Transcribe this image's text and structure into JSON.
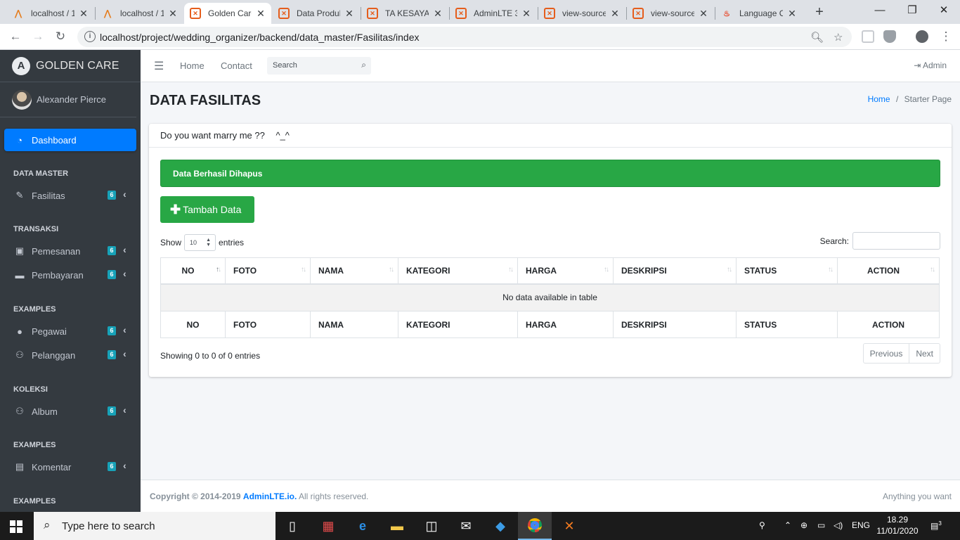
{
  "browser": {
    "tabs": [
      {
        "title": "localhost / 1",
        "icon": "phpmyadmin-icon"
      },
      {
        "title": "localhost / 1",
        "icon": "phpmyadmin-icon"
      },
      {
        "title": "Golden Care",
        "icon": "xampp-icon",
        "active": true
      },
      {
        "title": "Data Produk",
        "icon": "xampp-icon"
      },
      {
        "title": "TA KESAYAN",
        "icon": "xampp-icon"
      },
      {
        "title": "AdminLTE 3",
        "icon": "xampp-icon"
      },
      {
        "title": "view-source",
        "icon": "xampp-icon"
      },
      {
        "title": "view-source",
        "icon": "xampp-icon"
      },
      {
        "title": "Language C",
        "icon": "flame-icon"
      }
    ],
    "url": "localhost/project/wedding_organizer/backend/data_master/Fasilitas/index"
  },
  "sidebar": {
    "brand": "GOLDEN CARE",
    "user": "Alexander Pierce",
    "dashboard": "Dashboard",
    "sections": [
      {
        "header": "DATA MASTER",
        "items": [
          {
            "label": "Fasilitas",
            "badge": "6",
            "icon": "edit-icon"
          }
        ]
      },
      {
        "header": "TRANSAKSI",
        "items": [
          {
            "label": "Pemesanan",
            "badge": "6",
            "icon": "briefcase-icon"
          },
          {
            "label": "Pembayaran",
            "badge": "6",
            "icon": "wallet-icon"
          }
        ]
      },
      {
        "header": "EXAMPLES",
        "items": [
          {
            "label": "Pegawai",
            "badge": "6",
            "icon": "user-icon"
          },
          {
            "label": "Pelanggan",
            "badge": "6",
            "icon": "users-icon"
          }
        ]
      },
      {
        "header": "KOLEKSI",
        "items": [
          {
            "label": "Album",
            "badge": "6",
            "icon": "users-icon"
          }
        ]
      },
      {
        "header": "EXAMPLES",
        "items": [
          {
            "label": "Komentar",
            "badge": "6",
            "icon": "book-icon"
          }
        ]
      },
      {
        "header": "EXAMPLES",
        "items": []
      }
    ]
  },
  "topnav": {
    "home": "Home",
    "contact": "Contact",
    "search_placeholder": "Search",
    "admin": "Admin"
  },
  "content": {
    "title": "DATA FASILITAS",
    "breadcrumb": {
      "home": "Home",
      "sep": "/",
      "current": "Starter Page"
    },
    "card_title": "Do you want marry me ??",
    "card_title_emoticon": "^_^",
    "alert": "Data Berhasil Dihapus",
    "add_button": "Tambah Data",
    "show_label": "Show",
    "entries_value": "10",
    "entries_label": "entries",
    "search_label": "Search:",
    "columns": [
      "NO",
      "FOTO",
      "NAMA",
      "KATEGORI",
      "HARGA",
      "DESKRIPSI",
      "STATUS",
      "ACTION"
    ],
    "empty": "No data available in table",
    "info": "Showing 0 to 0 of 0 entries",
    "prev": "Previous",
    "next": "Next"
  },
  "footer": {
    "copyright": "Copyright © 2014-2019",
    "link": "AdminLTE.io.",
    "rights": "All rights reserved.",
    "right": "Anything you want"
  },
  "taskbar": {
    "search_placeholder": "Type here to search",
    "lang": "ENG",
    "time": "18.29",
    "date": "11/01/2020",
    "notifications": "3"
  },
  "colors": {
    "primary": "#007bff",
    "success": "#28a745",
    "sidebar": "#343a40",
    "badge": "#17a2b8"
  }
}
